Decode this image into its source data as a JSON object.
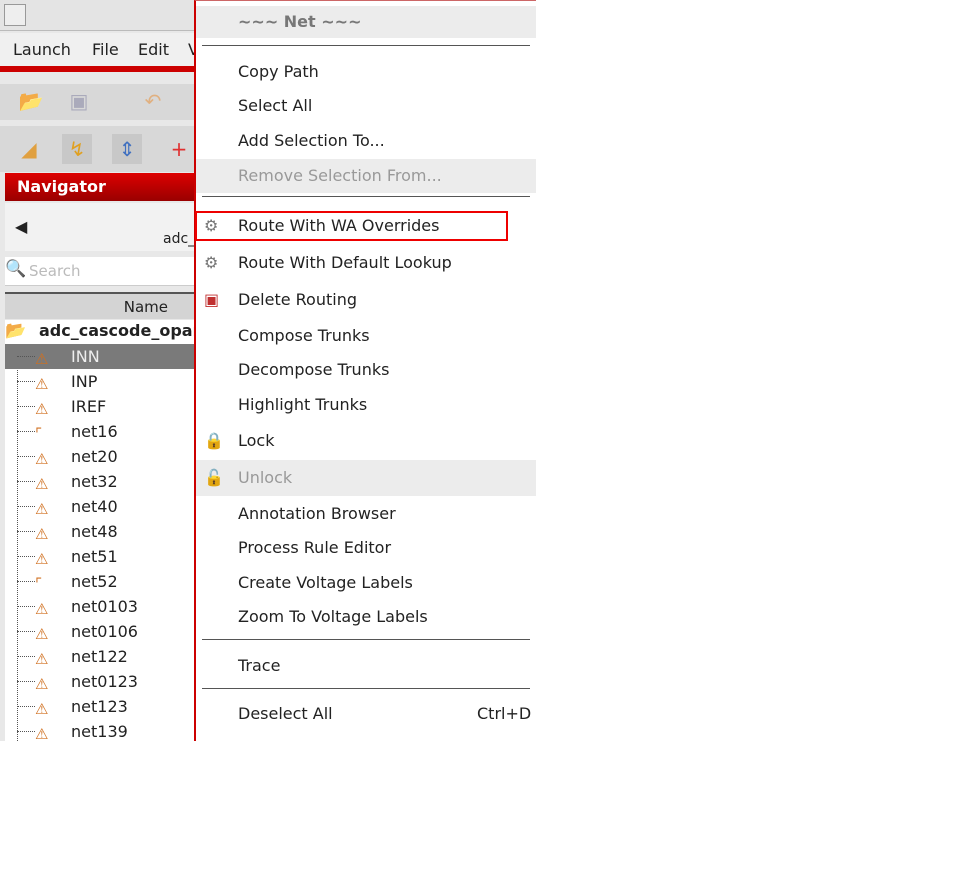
{
  "menubar": {
    "items": [
      "Launch",
      "File",
      "Edit",
      "V"
    ]
  },
  "navigator": {
    "title": "Navigator",
    "path": "adc_",
    "search_placeholder": "Search",
    "column": "Name"
  },
  "tree": {
    "root": "adc_cascode_opam",
    "items": [
      "INN",
      "INP",
      "IREF",
      "net16",
      "net20",
      "net32",
      "net40",
      "net48",
      "net51",
      "net52",
      "net0103",
      "net0106",
      "net122",
      "net0123",
      "net123",
      "net139"
    ],
    "selected": "INN"
  },
  "context_menu": {
    "title": "~~~ Net ~~~",
    "items": {
      "copy_path": "Copy Path",
      "select_all": "Select All",
      "add_selection": "Add Selection To...",
      "remove_selection": "Remove Selection From...",
      "route_wa": "Route With WA Overrides",
      "route_default": "Route With Default Lookup",
      "delete_routing": "Delete Routing",
      "compose": "Compose Trunks",
      "decompose": "Decompose Trunks",
      "highlight": "Highlight Trunks",
      "lock": "Lock",
      "unlock": "Unlock",
      "annotation": "Annotation Browser",
      "process_rule": "Process Rule Editor",
      "create_voltage": "Create Voltage Labels",
      "zoom_voltage": "Zoom To Voltage Labels",
      "trace": "Trace",
      "deselect_all": "Deselect All",
      "deselect_shortcut": "Ctrl+D"
    }
  },
  "colors": {
    "accent": "#cc0000",
    "highlight_box": "#ee0000"
  }
}
